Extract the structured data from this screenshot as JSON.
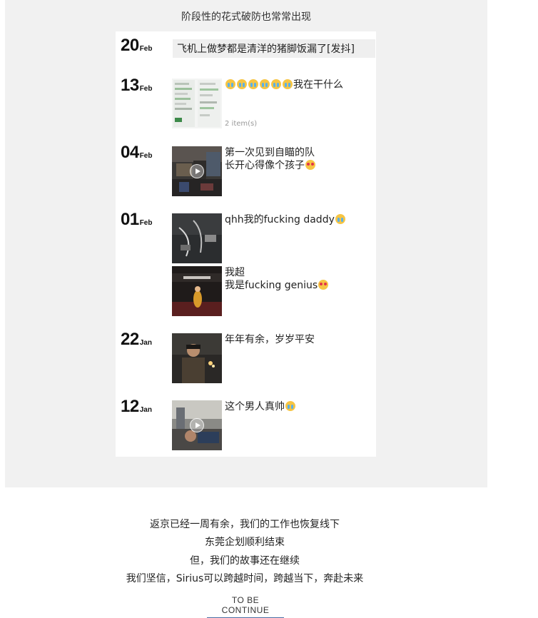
{
  "caption": "阶段性的花式破防也常常出现",
  "timeline": {
    "entries": [
      {
        "day": "20",
        "month": "Feb",
        "text": "飞机上做梦都是清洋的猪脚饭漏了[发抖]"
      },
      {
        "day": "13",
        "month": "Feb",
        "text": "我在干什么",
        "sub": "2 item(s)"
      },
      {
        "day": "04",
        "month": "Feb",
        "line1": "第一次见到自瞄的队",
        "line2": "长开心得像个孩子"
      },
      {
        "day": "01",
        "month": "Feb",
        "text": "qhh我的fucking daddy",
        "text2a": "我超",
        "text2b": "我是fucking genius"
      },
      {
        "day": "22",
        "month": "Jan",
        "text": "年年有余，岁岁平安"
      },
      {
        "day": "12",
        "month": "Jan",
        "text": "这个男人真帅"
      }
    ]
  },
  "footer": {
    "line1": "返京已经一周有余，我们的工作也恢复线下",
    "line2": "东莞企划顺利结束",
    "line3": "但，我们的故事还在继续",
    "line4": "我们坚信，Sirius可以跨越时间，跨越当下，奔赴未来",
    "continue": "TO BE CONTINUE"
  },
  "icons": [
    "cry-emoji-icon",
    "heart-eyes-emoji-icon",
    "play-icon"
  ],
  "colors": {
    "panel_bg": "#f1f1f1",
    "link_underline": "#4a6fa5"
  }
}
